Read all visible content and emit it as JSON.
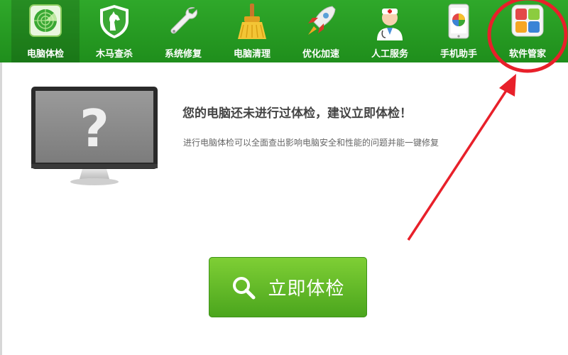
{
  "toolbar": {
    "active_color": "#1b7d18",
    "tabs": [
      {
        "label": "电脑体检",
        "icon": "radar-scan-icon",
        "active": true
      },
      {
        "label": "木马查杀",
        "icon": "horse-shield-icon"
      },
      {
        "label": "系统修复",
        "icon": "wrench-icon"
      },
      {
        "label": "电脑清理",
        "icon": "broom-icon"
      },
      {
        "label": "优化加速",
        "icon": "rocket-icon"
      },
      {
        "label": "人工服务",
        "icon": "doctor-icon"
      },
      {
        "label": "手机助手",
        "icon": "phone-icon"
      },
      {
        "label": "软件管家",
        "icon": "software-grid-icon"
      }
    ]
  },
  "main": {
    "monitor_icon": "monitor-question-icon",
    "heading": "您的电脑还未进行过体检，建议立即体检！",
    "subtext": "进行电脑体检可以全面查出影响电脑安全和性能的问题并能一键修复",
    "button_label": "立即体检",
    "button_icon": "search-icon"
  },
  "annotation": {
    "color": "#e8202a",
    "shapes": [
      "circle-highlight",
      "arrow"
    ]
  }
}
